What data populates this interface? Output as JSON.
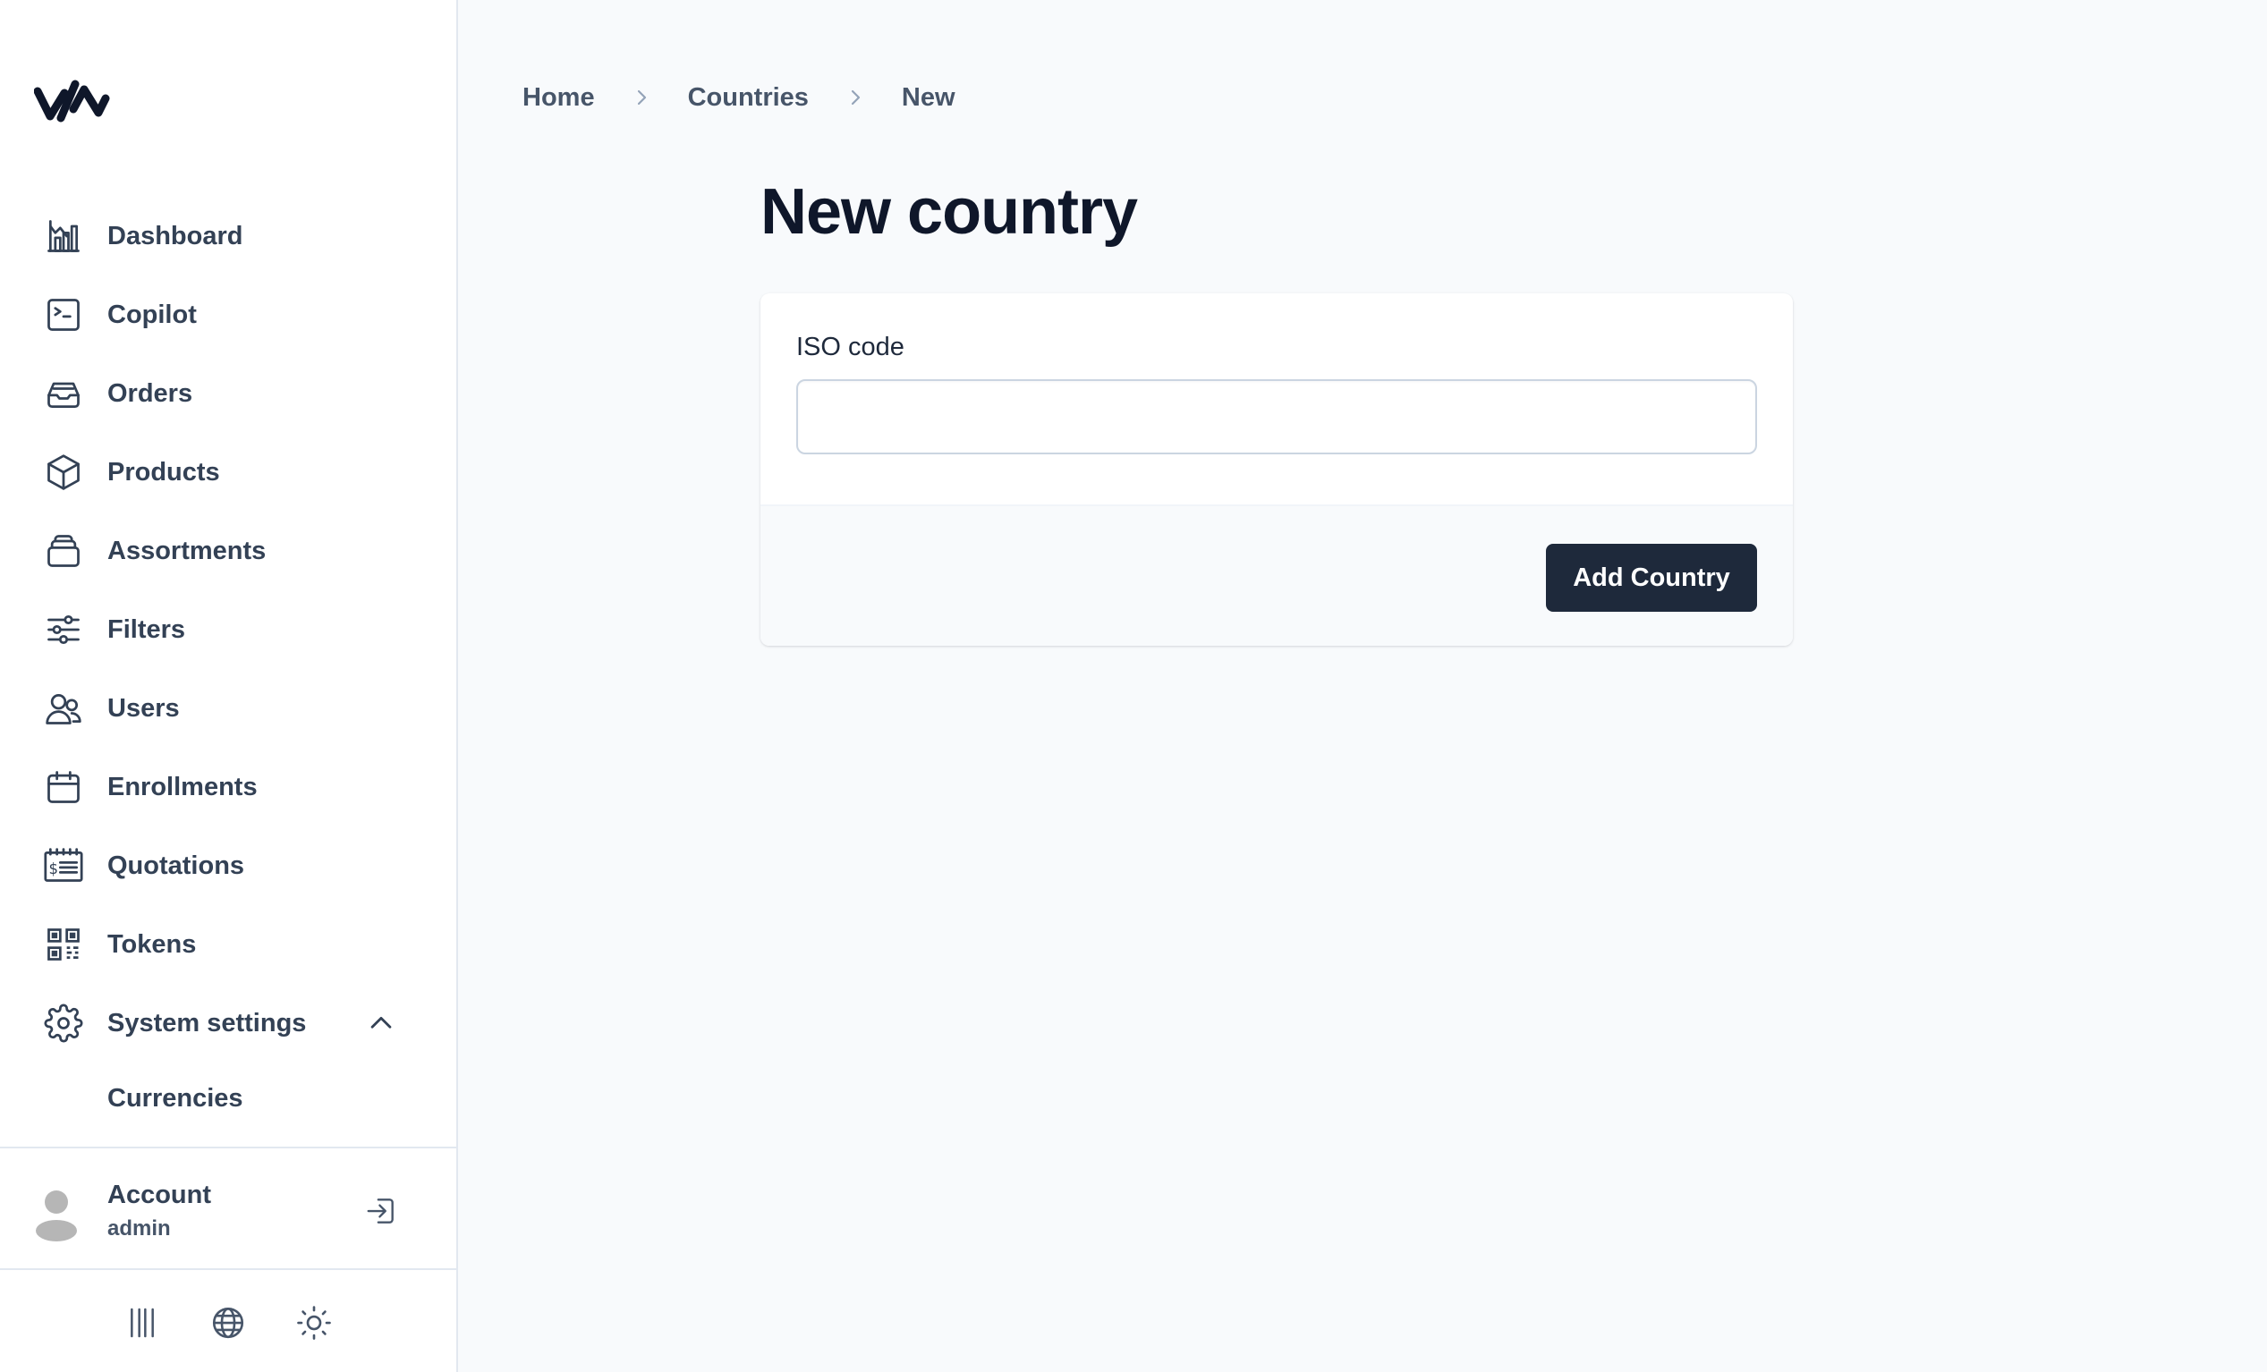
{
  "sidebar": {
    "logo_icon": "unchained-logo-icon",
    "items": [
      {
        "label": "Dashboard",
        "icon": "chart-bar-icon"
      },
      {
        "label": "Copilot",
        "icon": "terminal-icon"
      },
      {
        "label": "Orders",
        "icon": "inbox-stack-icon"
      },
      {
        "label": "Products",
        "icon": "cube-icon"
      },
      {
        "label": "Assortments",
        "icon": "rectangle-stack-icon"
      },
      {
        "label": "Filters",
        "icon": "adjustments-icon"
      },
      {
        "label": "Users",
        "icon": "users-icon"
      },
      {
        "label": "Enrollments",
        "icon": "calendar-icon"
      },
      {
        "label": "Quotations",
        "icon": "receipt-icon"
      },
      {
        "label": "Tokens",
        "icon": "qr-code-icon"
      },
      {
        "label": "System settings",
        "icon": "gear-icon",
        "expanded": true
      }
    ],
    "subitems": [
      {
        "label": "Currencies"
      }
    ],
    "account": {
      "name": "Account",
      "role": "admin"
    },
    "tools": [
      "barcode-icon",
      "globe-icon",
      "sun-icon"
    ]
  },
  "breadcrumb": {
    "items": [
      "Home",
      "Countries",
      "New"
    ]
  },
  "page": {
    "title": "New country"
  },
  "form": {
    "iso_label": "ISO code",
    "iso_value": "",
    "submit_label": "Add Country"
  },
  "colors": {
    "primary": "#1e293b",
    "background": "#f8fafc",
    "text": "#334155"
  }
}
